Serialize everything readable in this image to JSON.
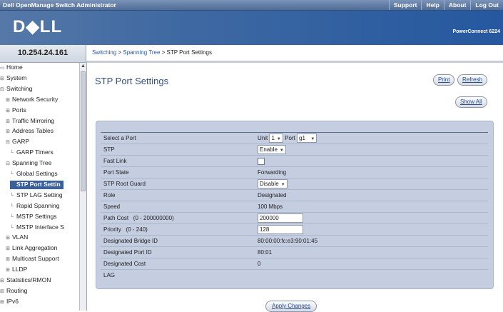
{
  "app": {
    "title": "Dell OpenManage Switch Administrator",
    "links": [
      "Support",
      "Help",
      "About",
      "Log Out"
    ],
    "logo": "D◆LL",
    "product": "PowerConnect 6224",
    "ip": "10.254.24.161"
  },
  "breadcrumb": {
    "part1": "Switching",
    "sep": " > ",
    "part2": "Spanning Tree",
    "part3": "STP Port Settings"
  },
  "nav": [
    {
      "label": "Home",
      "icon": "home-icon",
      "ex": ""
    },
    {
      "label": "System",
      "ex": "⊞"
    },
    {
      "label": "Switching",
      "ex": "⊟"
    },
    {
      "label": "Network Security",
      "ex": "⊞"
    },
    {
      "label": "Ports",
      "ex": "⊞"
    },
    {
      "label": "Traffic Mirroring",
      "ex": "⊞"
    },
    {
      "label": "Address Tables",
      "ex": "⊞"
    },
    {
      "label": "GARP",
      "ex": "⊟"
    },
    {
      "label": "GARP Timers",
      "ex": ""
    },
    {
      "label": "Spanning Tree",
      "ex": "⊟"
    },
    {
      "label": "Global Settings",
      "ex": ""
    },
    {
      "label": "STP Port Settin",
      "ex": "",
      "selected": true
    },
    {
      "label": "STP LAG Setting",
      "ex": ""
    },
    {
      "label": "Rapid Spanning",
      "ex": ""
    },
    {
      "label": "MSTP Settings",
      "ex": ""
    },
    {
      "label": "MSTP Interface S",
      "ex": ""
    },
    {
      "label": "VLAN",
      "ex": "⊞"
    },
    {
      "label": "Link Aggregation",
      "ex": "⊞"
    },
    {
      "label": "Multicast Support",
      "ex": "⊞"
    },
    {
      "label": "LLDP",
      "ex": "⊞"
    },
    {
      "label": "Statistics/RMON",
      "ex": "⊞"
    },
    {
      "label": "Routing",
      "ex": "⊞"
    },
    {
      "label": "IPv6",
      "ex": "⊞"
    }
  ],
  "page": {
    "title": "STP Port Settings",
    "print": "Print",
    "refresh": "Refresh",
    "show_all": "Show All",
    "apply": "Apply Changes"
  },
  "form": {
    "select_port_label": "Select a Port",
    "unit_label": "Unit",
    "unit_value": "1",
    "port_label": "Port",
    "port_value": "g1",
    "stp_label": "STP",
    "stp_value": "Enable",
    "fast_link_label": "Fast Link",
    "fast_link_checked": false,
    "port_state_label": "Port State",
    "port_state_value": "Forwarding",
    "root_guard_label": "STP Root Guard",
    "root_guard_value": "Disable",
    "role_label": "Role",
    "role_value": "Designated",
    "speed_label": "Speed",
    "speed_value": "100 Mbps",
    "path_cost_label": "Path Cost   (0 - 200000000)",
    "path_cost_value": "200000",
    "priority_label": "Priority   (0 - 240)",
    "priority_value": "128",
    "bridge_id_label": "Designated Bridge ID",
    "bridge_id_value": "80:00:00:fc:e3:90:01:45",
    "port_id_label": "Designated Port ID",
    "port_id_value": "80:01",
    "cost_label": "Designated Cost",
    "cost_value": "0",
    "lag_label": "LAG",
    "lag_value": ""
  }
}
